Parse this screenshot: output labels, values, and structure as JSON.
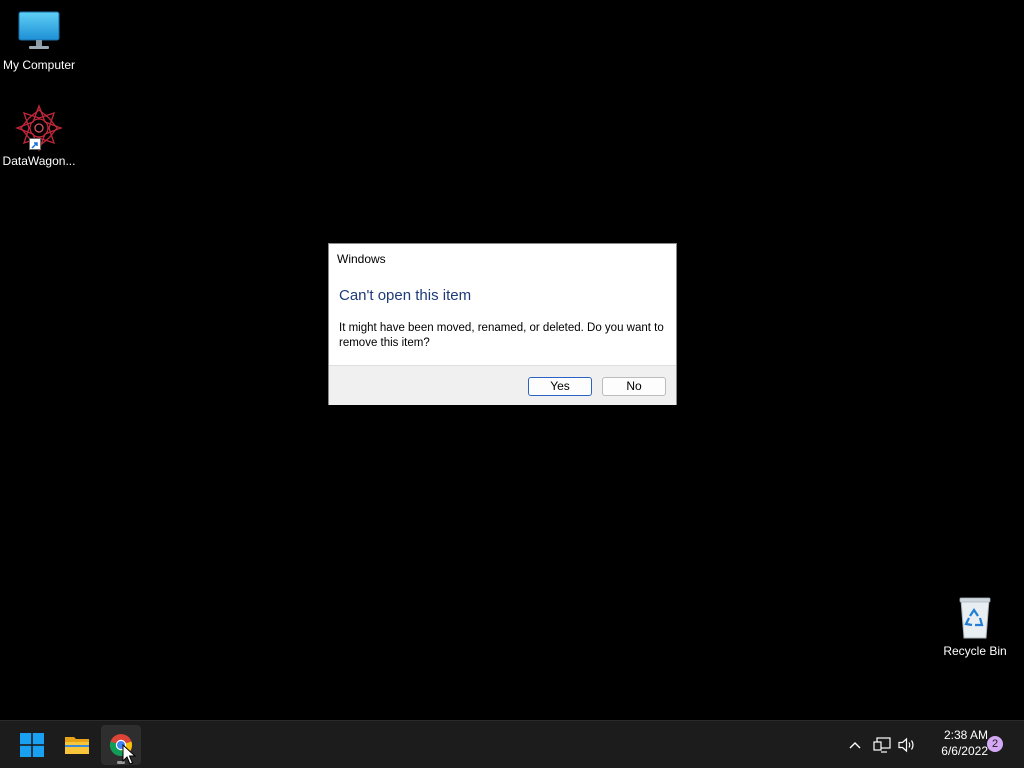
{
  "desktop": {
    "icons": [
      {
        "label": "My Computer",
        "icon": "monitor-icon"
      },
      {
        "label": "DataWagon...",
        "icon": "datawagon-app-icon"
      },
      {
        "label": "Recycle Bin",
        "icon": "recycle-bin-icon"
      }
    ]
  },
  "dialog": {
    "title": "Windows",
    "heading": "Can't open this item",
    "message": "It might have been moved, renamed, or deleted. Do you want to remove this item?",
    "yes_label": "Yes",
    "no_label": "No"
  },
  "taskbar": {
    "pinned": [
      {
        "name": "Start",
        "icon": "windows-logo-icon"
      },
      {
        "name": "File Explorer",
        "icon": "folder-icon"
      },
      {
        "name": "Google Chrome",
        "icon": "chrome-icon",
        "active": true
      }
    ],
    "tray": [
      "chevron-up-icon",
      "network-icon",
      "volume-icon"
    ],
    "time": "2:38 AM",
    "date": "6/6/2022",
    "notification_count": "2"
  },
  "colors": {
    "desktop_bg": "#000000",
    "taskbar_bg": "#1c1c1c",
    "dialog_heading": "#1e3a78",
    "accent_button_border": "#2a63c4",
    "notification_badge": "#d4a8f5"
  }
}
